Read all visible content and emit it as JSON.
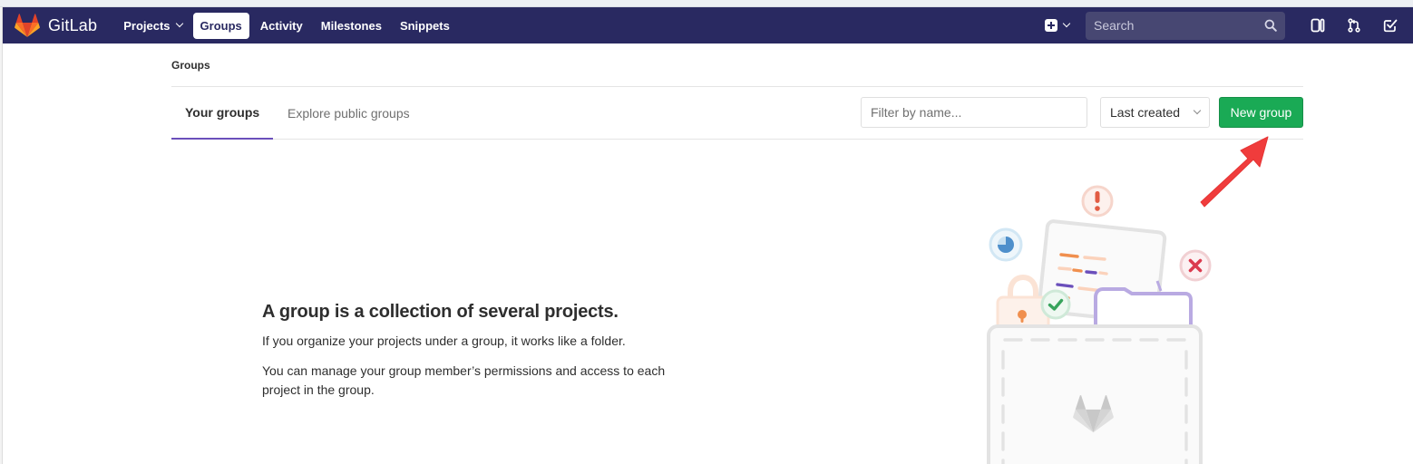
{
  "app": {
    "name": "GitLab",
    "accent": "#6b4fbb",
    "navbar_color": "#292961",
    "success_color": "#1aaa55"
  },
  "nav": {
    "items": [
      {
        "label": "Projects",
        "has_dropdown": true
      },
      {
        "label": "Groups",
        "active": true
      },
      {
        "label": "Activity"
      },
      {
        "label": "Milestones"
      },
      {
        "label": "Snippets"
      }
    ],
    "search_placeholder": "Search",
    "icons": [
      "gitlab-logo-icon",
      "plus-square-icon",
      "chevron-down-icon",
      "search-icon",
      "sidebar-toggle-icon",
      "merge-request-icon",
      "todo-check-icon"
    ]
  },
  "breadcrumb": {
    "current": "Groups"
  },
  "tabs": [
    {
      "label": "Your groups",
      "active": true
    },
    {
      "label": "Explore public groups"
    }
  ],
  "filter": {
    "placeholder": "Filter by name..."
  },
  "sort": {
    "selected": "Last created"
  },
  "new_group_button": {
    "label": "New group"
  },
  "empty_state": {
    "title": "A group is a collection of several projects.",
    "line1": "If you organize your projects under a group, it works like a folder.",
    "line2": "You can manage your group member’s permissions and access to each project in the group."
  },
  "annotation": {
    "arrow_color": "#f03c3c"
  }
}
